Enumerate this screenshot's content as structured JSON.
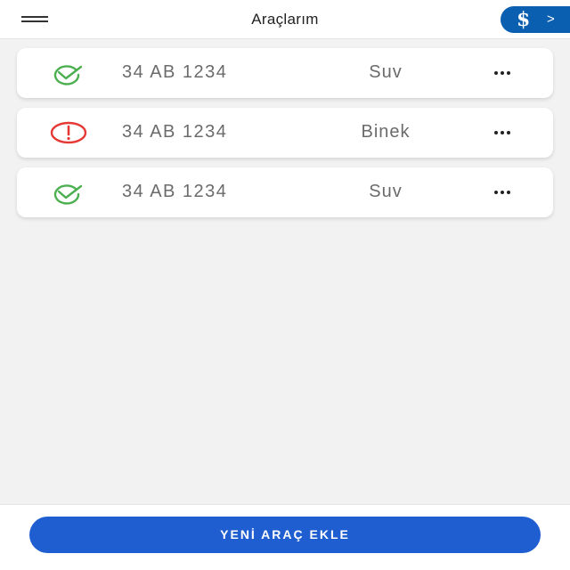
{
  "header": {
    "title": "Araçlarım",
    "brand_logo": "$",
    "brand_chevron": ">",
    "menu_icon": "hamburger-menu-icon"
  },
  "vehicles": [
    {
      "plate": "34 AB 1234",
      "type": "Suv",
      "status": "ok",
      "status_icon": "check-circle-icon",
      "status_color": "#4caf50"
    },
    {
      "plate": "34 AB 1234",
      "type": "Binek",
      "status": "warning",
      "status_icon": "exclamation-circle-icon",
      "status_color": "#e53935"
    },
    {
      "plate": "34 AB 1234",
      "type": "Suv",
      "status": "ok",
      "status_icon": "check-circle-icon",
      "status_color": "#4caf50"
    }
  ],
  "footer": {
    "add_button_label": "YENİ ARAÇ EKLE"
  },
  "colors": {
    "primary_button": "#1f5ed0",
    "brand": "#0b5fb0",
    "ok": "#4caf50",
    "warning": "#e53935"
  }
}
